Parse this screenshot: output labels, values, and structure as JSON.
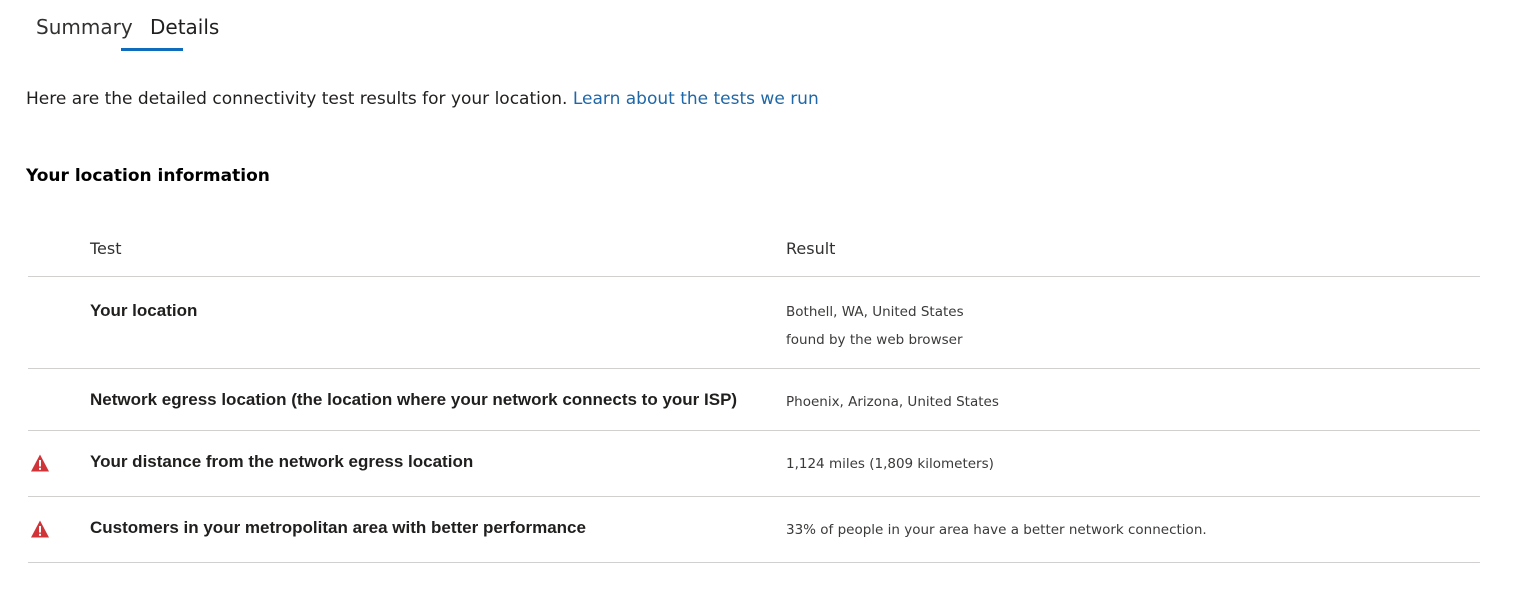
{
  "tabs": [
    {
      "label": "Summary",
      "selected": false
    },
    {
      "label": "Details",
      "selected": true
    }
  ],
  "intro": {
    "text": "Here are the detailed connectivity test results for your location.",
    "link": "Learn about the tests we run"
  },
  "section": {
    "title": "Your location information"
  },
  "table": {
    "headers": {
      "test": "Test",
      "result": "Result"
    },
    "rows": [
      {
        "icon": "",
        "test": "Your location",
        "result": [
          "Bothell, WA, United States",
          "found by the web browser"
        ]
      },
      {
        "icon": "",
        "test": "Network egress location (the location where your network connects to your ISP)",
        "result": [
          "Phoenix, Arizona, United States"
        ]
      },
      {
        "icon": "warning-icon",
        "test": "Your distance from the network egress location",
        "result": [
          "1,124 miles (1,809 kilometers)"
        ]
      },
      {
        "icon": "warning-icon",
        "test": "Customers in your metropolitan area with better performance",
        "result": [
          "33% of people in your area have a better network connection."
        ]
      }
    ]
  },
  "colors": {
    "accent": "#0f6cbd",
    "link": "#1f67a6",
    "warning": "#d13438",
    "divider": "#d2d0ce"
  }
}
